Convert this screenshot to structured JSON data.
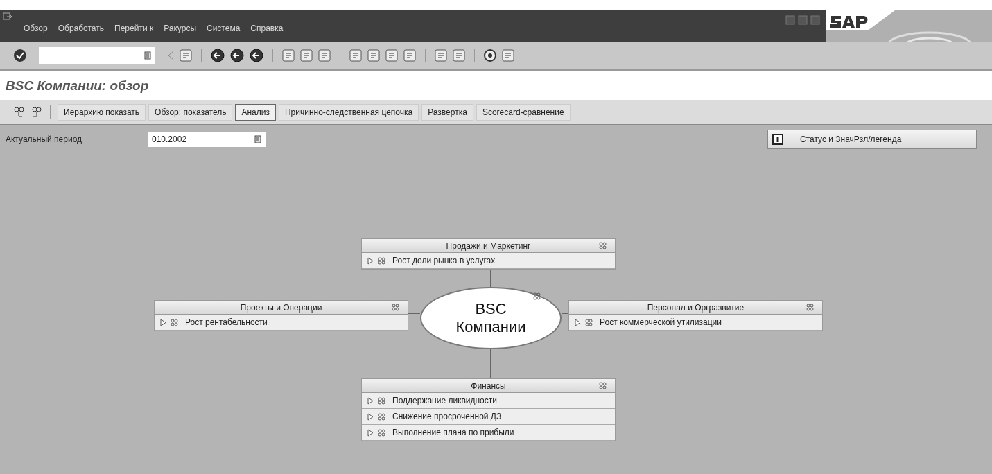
{
  "menu": [
    "Обзор",
    "Обработать",
    "Перейти к",
    "Ракурсы",
    "Система",
    "Справка"
  ],
  "title": "BSC Компании: обзор",
  "app_toolbar": [
    {
      "label": "Иерархию показать",
      "selected": false
    },
    {
      "label": "Обзор: показатель",
      "selected": false
    },
    {
      "label": "Анализ",
      "selected": true
    },
    {
      "label": "Причинно-следственная цепочка",
      "selected": false
    },
    {
      "label": "Развертка",
      "selected": false
    },
    {
      "label": "Scorecard-сравнение",
      "selected": false
    }
  ],
  "period": {
    "label": "Актуальный период",
    "value": "010.2002"
  },
  "legend_button": "Статус и ЗначРзл/легенда",
  "center": {
    "line1": "BSC",
    "line2": "Компании"
  },
  "perspectives": [
    {
      "title": "Продажи и Маркетинг",
      "objectives": [
        "Рост доли рынка в услугах"
      ]
    },
    {
      "title": "Проекты и Операции",
      "objectives": [
        "Рост рентабельности"
      ]
    },
    {
      "title": "Персонал и Оргразвитие",
      "objectives": [
        "Рост коммерческой утилизации"
      ]
    },
    {
      "title": "Финансы",
      "objectives": [
        "Поддержание ликвидности",
        "Снижение просроченной ДЗ",
        "Выполнение плана по прибыли"
      ]
    }
  ]
}
